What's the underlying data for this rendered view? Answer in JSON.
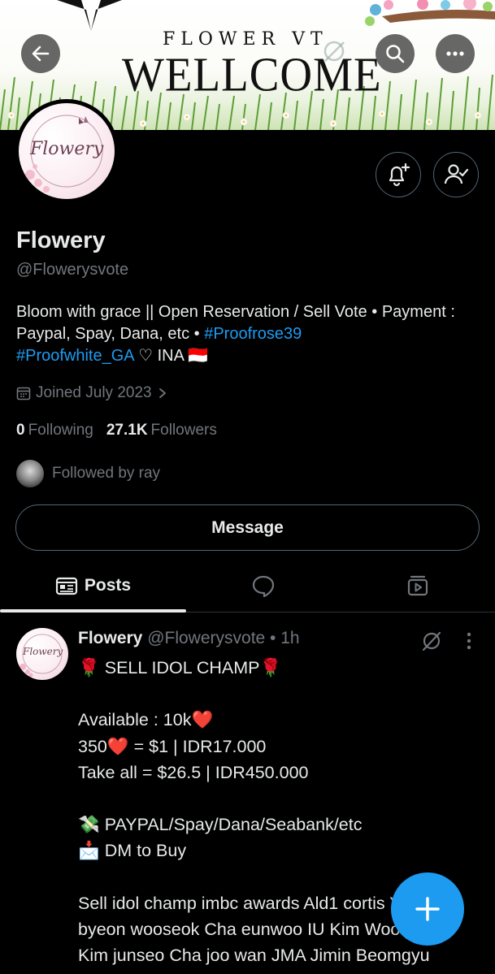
{
  "banner": {
    "line1": "FLOWER VT",
    "line2": "WELLCOME"
  },
  "header_buttons": {
    "back_icon": "arrow-left-icon",
    "search_icon": "search-icon",
    "more_icon": "more-horizontal-icon"
  },
  "profile": {
    "avatar_text": "Flowery",
    "name": "Flowery",
    "handle": "@Flowerysvote",
    "bio_text": "Bloom with grace || Open Reservation / Sell Vote • Payment : Paypal, Spay, Dana, etc • ",
    "bio_tag1": "#Proofrose39",
    "bio_tag2": "#Proofwhite_GA",
    "bio_tail": " ♡ INA 🇮🇩",
    "joined": "Joined July 2023",
    "following_count": "0",
    "following_label": "Following",
    "followers_count": "27.1K",
    "followers_label": "Followers",
    "followed_by": "Followed by ray",
    "message_button": "Message"
  },
  "tabs": {
    "posts_label": "Posts",
    "replies_icon": "speech-bubble-icon",
    "media_icon": "media-play-icon"
  },
  "post": {
    "avatar_text": "Flowery",
    "name": "Flowery",
    "meta": " @Flowerysvote • 1h",
    "body": "🌹 SELL IDOL CHAMP🌹\n\nAvailable : 10k❤️\n350❤️ = $1 | IDR17.000\nTake all = $26.5 | IDR450.000\n\n💸 PAYPAL/Spay/Dana/Seabank/etc\n📩 DM to Buy\n\nSell idol champ imbc awards Ald1 cortis Yoo\nbyeon wooseok Cha eunwoo IU Kim Woo-jon\nKim junseo Cha joo wan JMA Jimin Beomgyu\nLisa Boys Fan Blink"
  },
  "colors": {
    "accent": "#1d9bf0",
    "text_primary": "#e7e9ea",
    "text_secondary": "#71767b",
    "border": "#536471",
    "background": "#000000"
  }
}
